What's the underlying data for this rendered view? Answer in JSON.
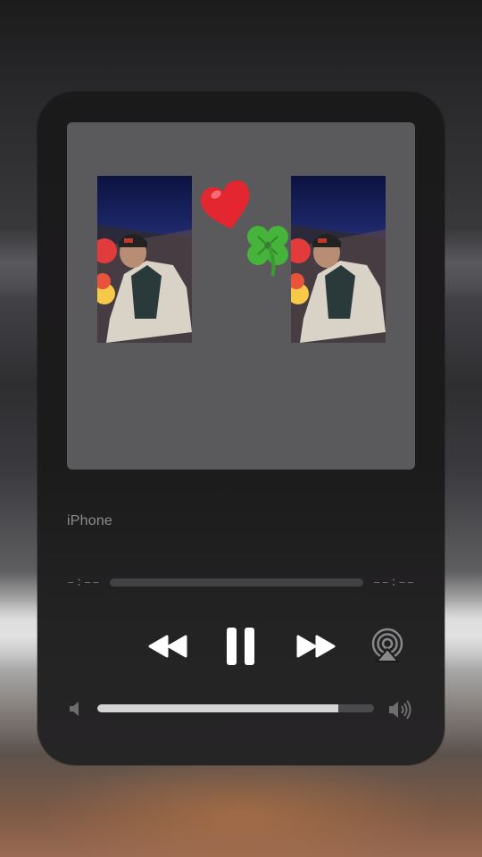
{
  "now_playing": {
    "device_name": "iPhone",
    "elapsed_time": "–:––",
    "remaining_time": "––:––",
    "playback_progress": 0.0
  },
  "artwork": {
    "emoji_heart": "❤️",
    "emoji_clover": "🍀"
  },
  "controls": {
    "rewind_icon": "rewind-icon",
    "pause_icon": "pause-icon",
    "forward_icon": "fast-forward-icon",
    "airplay_icon": "airplay-icon"
  },
  "volume": {
    "level": 0.87,
    "low_icon": "speaker-low-icon",
    "high_icon": "speaker-high-icon"
  },
  "colors": {
    "panel": "#1c1b1c",
    "artwork_bg": "#5a5a5c",
    "text_muted": "#8e8c8e",
    "track": "#424143",
    "volume_fill": "#d4d4d4"
  }
}
